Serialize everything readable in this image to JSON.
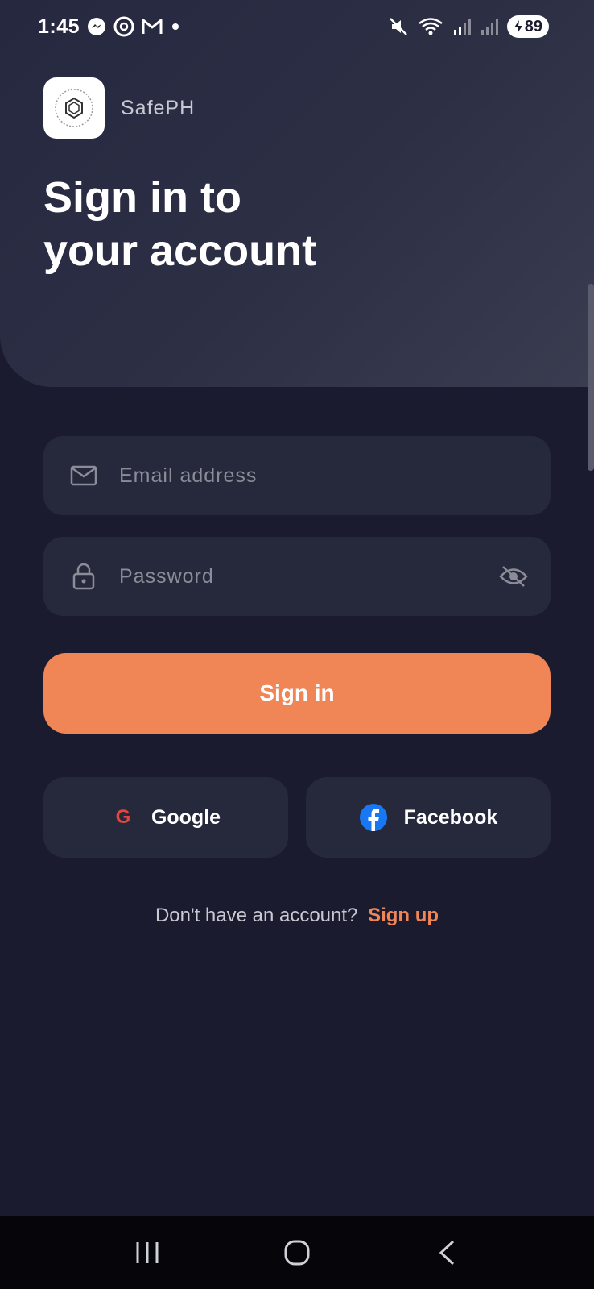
{
  "status_bar": {
    "time": "1:45",
    "battery": "89",
    "icons": [
      "messenger-icon",
      "threads-icon",
      "gmail-icon",
      "dot-icon",
      "mute-icon",
      "wifi-icon",
      "signal-icon",
      "signal-icon",
      "battery-charging-icon"
    ]
  },
  "brand": {
    "name": "SafePH",
    "logo_icon": "safeph-logo-icon"
  },
  "title": "Sign in to\nyour account",
  "form": {
    "email_placeholder": "Email address",
    "email_value": "",
    "password_placeholder": "Password",
    "password_value": "",
    "signin_label": "Sign in"
  },
  "social": {
    "google_label": "Google",
    "google_mark": "G",
    "facebook_label": "Facebook"
  },
  "signup": {
    "prompt": "Don't have an account?",
    "link": "Sign up"
  },
  "colors": {
    "background": "#1b1b2f",
    "accent": "#f08556",
    "field": "#26283c",
    "google": "#e0473e",
    "facebook": "#1877f2"
  }
}
